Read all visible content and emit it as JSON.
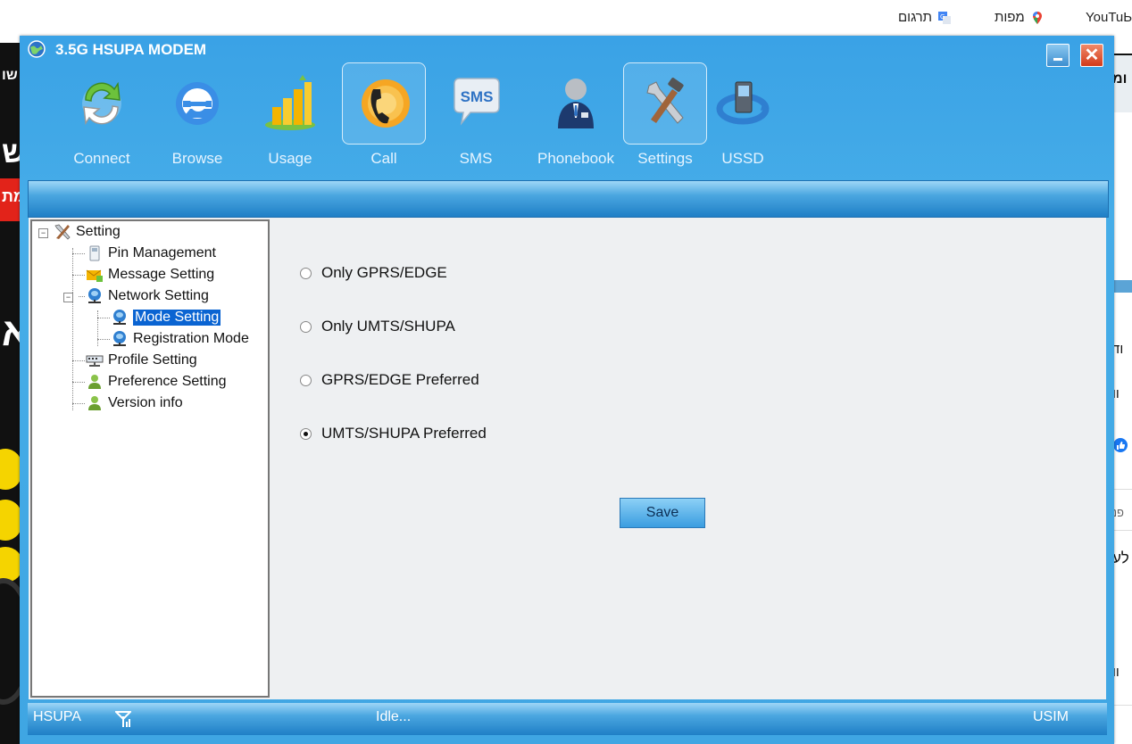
{
  "browser": {
    "bookmarks": [
      {
        "label": "YouTuЬ",
        "icon": "youtube-icon"
      },
      {
        "label": "מפות",
        "icon": "maps-pin-icon"
      },
      {
        "label": "תרגום",
        "icon": "translate-icon"
      }
    ]
  },
  "background": {
    "left_texts": [
      "שו",
      "ש",
      "מת",
      "א"
    ],
    "right_texts": [
      "ומ",
      "וד",
      "וו",
      "פנ",
      "לע",
      "וו"
    ]
  },
  "window": {
    "title": "3.5G HSUPA MODEM",
    "close_glyph": "✕"
  },
  "toolbar": {
    "items": [
      {
        "label": "Connect",
        "icon": "connect-icon"
      },
      {
        "label": "Browse",
        "icon": "browser-e-icon"
      },
      {
        "label": "Usage",
        "icon": "usage-bar-chart-icon"
      },
      {
        "label": "Call",
        "icon": "phone-call-icon"
      },
      {
        "label": "SMS",
        "icon": "sms-bubble-icon"
      },
      {
        "label": "Phonebook",
        "icon": "phonebook-person-icon"
      },
      {
        "label": "Settings",
        "icon": "settings-tools-icon"
      },
      {
        "label": "USSD",
        "icon": "ussd-device-icon"
      }
    ],
    "selected": [
      "Call",
      "Settings"
    ]
  },
  "tree": {
    "root": "Setting",
    "items": [
      {
        "label": "Pin Management"
      },
      {
        "label": "Message Setting"
      },
      {
        "label": "Network Setting"
      },
      {
        "label": "Mode Setting",
        "selected": true
      },
      {
        "label": "Registration Mode"
      },
      {
        "label": "Profile Setting"
      },
      {
        "label": "Preference Setting"
      },
      {
        "label": "Version info"
      }
    ]
  },
  "mode": {
    "options": [
      {
        "label": "Only GPRS/EDGE",
        "checked": false
      },
      {
        "label": "Only UMTS/SHUPA",
        "checked": false
      },
      {
        "label": "GPRS/EDGE Preferred",
        "checked": false
      },
      {
        "label": "UMTS/SHUPA Preferred",
        "checked": true
      }
    ],
    "save_label": "Save"
  },
  "status": {
    "network": "HSUPA",
    "state": "Idle...",
    "sim": "USIM"
  },
  "colors": {
    "window_blue": "#3fa6e3",
    "selection_blue": "#0a64d2",
    "close_red": "#d23a1a"
  }
}
